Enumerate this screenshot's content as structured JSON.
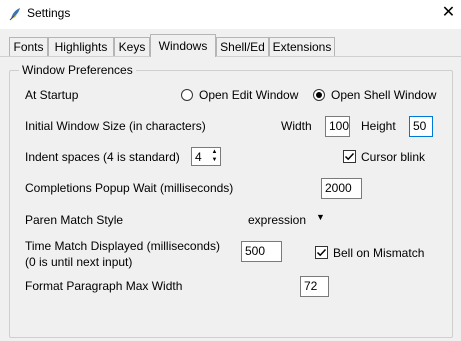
{
  "window": {
    "title": "Settings",
    "close_glyph": "✕",
    "icon": "python-feather-icon"
  },
  "tabs": [
    {
      "label": "Fonts",
      "selected": false
    },
    {
      "label": "Highlights",
      "selected": false
    },
    {
      "label": "Keys",
      "selected": false
    },
    {
      "label": "Windows",
      "selected": true
    },
    {
      "label": "Shell/Ed",
      "selected": false
    },
    {
      "label": "Extensions",
      "selected": false
    }
  ],
  "group": {
    "title": "Window Preferences",
    "at_startup": {
      "label": "At Startup",
      "options": [
        {
          "label": "Open Edit Window",
          "selected": false
        },
        {
          "label": "Open Shell Window",
          "selected": true
        }
      ]
    },
    "window_size": {
      "label": "Initial Window Size  (in characters)",
      "width_label": "Width",
      "width_value": "100",
      "height_label": "Height",
      "height_value": "50"
    },
    "indent": {
      "label": "Indent spaces (4 is standard)",
      "value": "4"
    },
    "cursor_blink": {
      "label": "Cursor blink",
      "checked": true
    },
    "completions": {
      "label": "Completions Popup Wait (milliseconds)",
      "value": "2000"
    },
    "paren_style": {
      "label": "Paren Match Style",
      "value": "expression"
    },
    "time_match": {
      "label_line1": "Time Match Displayed (milliseconds)",
      "label_line2": "(0 is until next input)",
      "value": "500"
    },
    "bell": {
      "label": "Bell on Mismatch",
      "checked": true
    },
    "paragraph": {
      "label": "Format Paragraph Max Width",
      "value": "72"
    }
  },
  "colors": {
    "background": "#f0f0f0",
    "focus_border": "#0078d7",
    "icon_blue": "#3a75b0",
    "icon_yellow": "#f5c518"
  }
}
